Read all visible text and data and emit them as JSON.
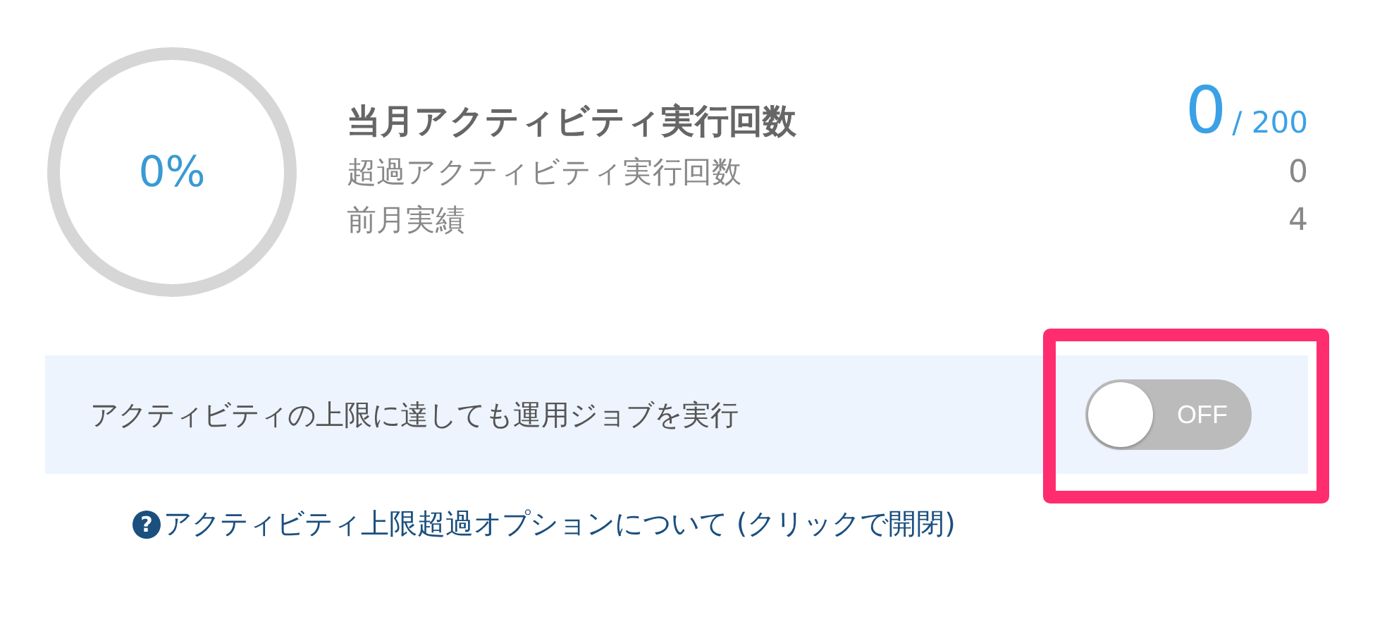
{
  "usage": {
    "percent": "0%",
    "level": 0,
    "title": "当月アクティビティ実行回数",
    "count": "0",
    "limit": "/ 200",
    "rows": [
      {
        "label": "超過アクティビティ実行回数",
        "value": "0"
      },
      {
        "label": "前月実績",
        "value": "4"
      }
    ]
  },
  "option": {
    "label": "アクティビティの上限に達しても運用ジョブを実行",
    "on": false,
    "switch_text": "OFF",
    "highlighted": true
  },
  "help_link": {
    "icon": "?",
    "text": "アクティビティ上限超過オプションについて (クリックで開閉)"
  }
}
